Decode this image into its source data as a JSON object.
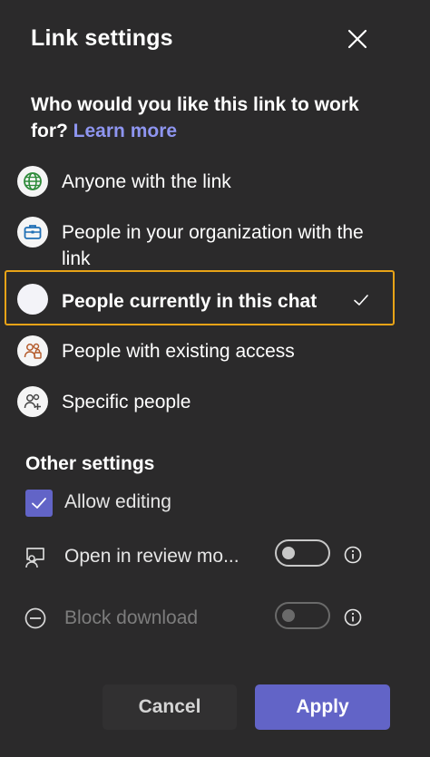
{
  "dialog": {
    "title": "Link settings",
    "question": "Who would you like this link to work for?",
    "learn_more": "Learn more"
  },
  "options": [
    {
      "label": "Anyone with the link",
      "icon": "globe-icon"
    },
    {
      "label": "People in your organization with the link",
      "icon": "briefcase-icon"
    },
    {
      "label": "People currently in this chat",
      "icon": "radio-selected",
      "selected": true
    },
    {
      "label": "People with existing access",
      "icon": "people-lock-icon"
    },
    {
      "label": "Specific people",
      "icon": "people-add-icon"
    }
  ],
  "other_settings": {
    "heading": "Other settings",
    "allow_editing": {
      "label": "Allow editing",
      "checked": true
    },
    "review_mode": {
      "label": "Open in review mo...",
      "on": false
    },
    "block_download": {
      "label": "Block download",
      "on": false,
      "disabled": true
    }
  },
  "buttons": {
    "cancel": "Cancel",
    "apply": "Apply"
  },
  "colors": {
    "background": "#2b2a2b",
    "accent": "#6264c7",
    "link": "#8e95f0",
    "focus_border": "#e8a317"
  }
}
